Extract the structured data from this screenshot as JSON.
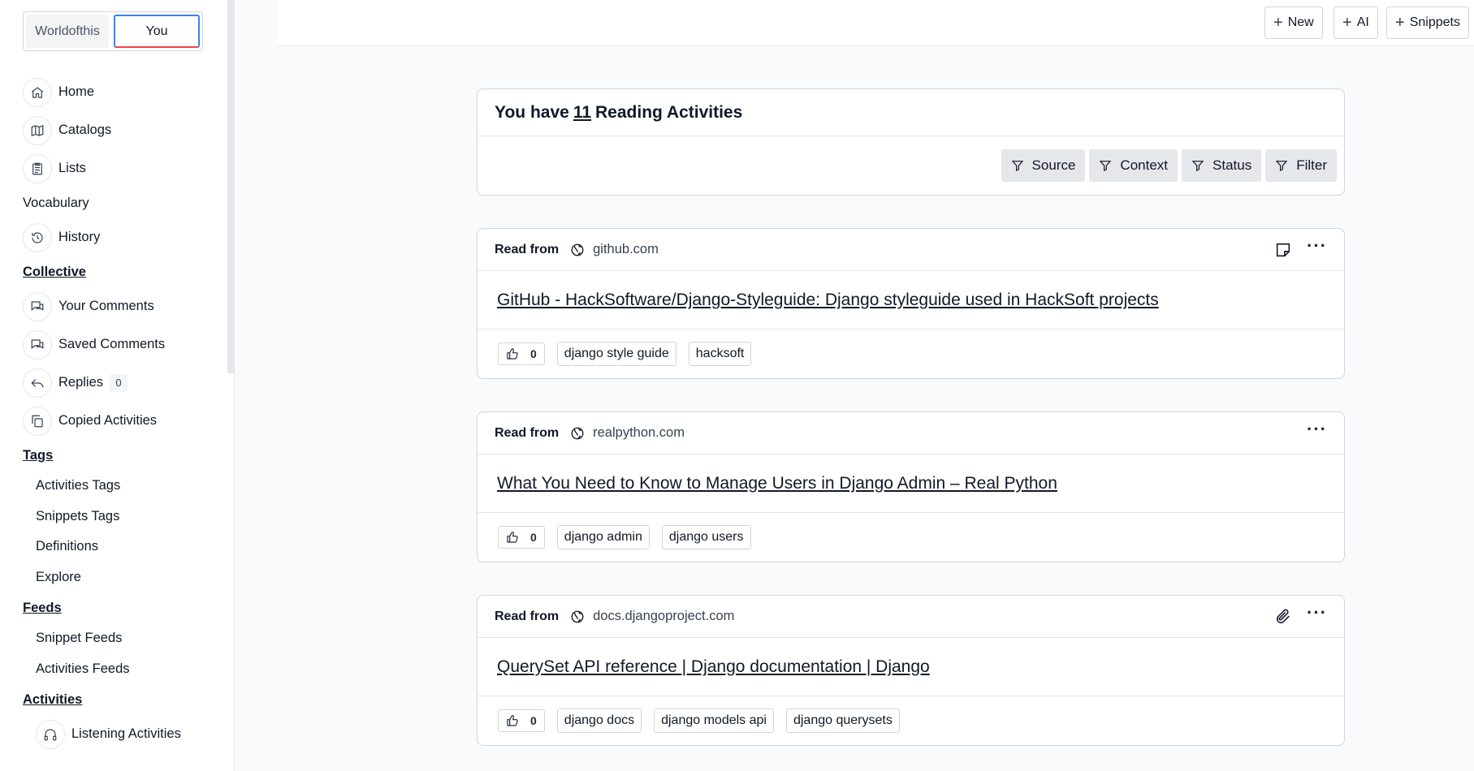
{
  "switcher": {
    "tabs": [
      "Worldofthis",
      "You"
    ],
    "active": "You"
  },
  "sidebar": {
    "home": "Home",
    "catalogs": "Catalogs",
    "lists": "Lists",
    "vocabulary": "Vocabulary",
    "history": "History",
    "collective": "Collective",
    "your_comments": "Your Comments",
    "saved_comments": "Saved Comments",
    "replies": "Replies",
    "replies_count": "0",
    "copied_activities": "Copied Activities",
    "tags": "Tags",
    "activities_tags": "Activities Tags",
    "snippets_tags": "Snippets Tags",
    "definitions": "Definitions",
    "explore": "Explore",
    "feeds": "Feeds",
    "snippet_feeds": "Snippet Feeds",
    "activities_feeds": "Activities Feeds",
    "activities": "Activities",
    "listening_activities": "Listening Activities"
  },
  "topbar": {
    "new_label": "New",
    "ai_label": "AI",
    "snippets_label": "Snippets"
  },
  "summary": {
    "prefix": "You have",
    "count": "11",
    "suffix": "Reading Activities",
    "filters": [
      "Source",
      "Context",
      "Status",
      "Filter"
    ]
  },
  "activities": [
    {
      "read_from": "Read from",
      "domain": "github.com",
      "title": "GitHub - HackSoftware/Django-Styleguide: Django styleguide used in HackSoft projects",
      "likes": "0",
      "tags": [
        "django style guide",
        "hacksoft"
      ],
      "icon": "note-icon"
    },
    {
      "read_from": "Read from",
      "domain": "realpython.com",
      "title": "What You Need to Know to Manage Users in Django Admin – Real Python",
      "likes": "0",
      "tags": [
        "django admin",
        "django users"
      ],
      "icon": ""
    },
    {
      "read_from": "Read from",
      "domain": "docs.djangoproject.com",
      "title": "QuerySet API reference | Django documentation | Django",
      "likes": "0",
      "tags": [
        "django docs",
        "django models api",
        "django querysets"
      ],
      "icon": "paperclip-icon"
    }
  ]
}
